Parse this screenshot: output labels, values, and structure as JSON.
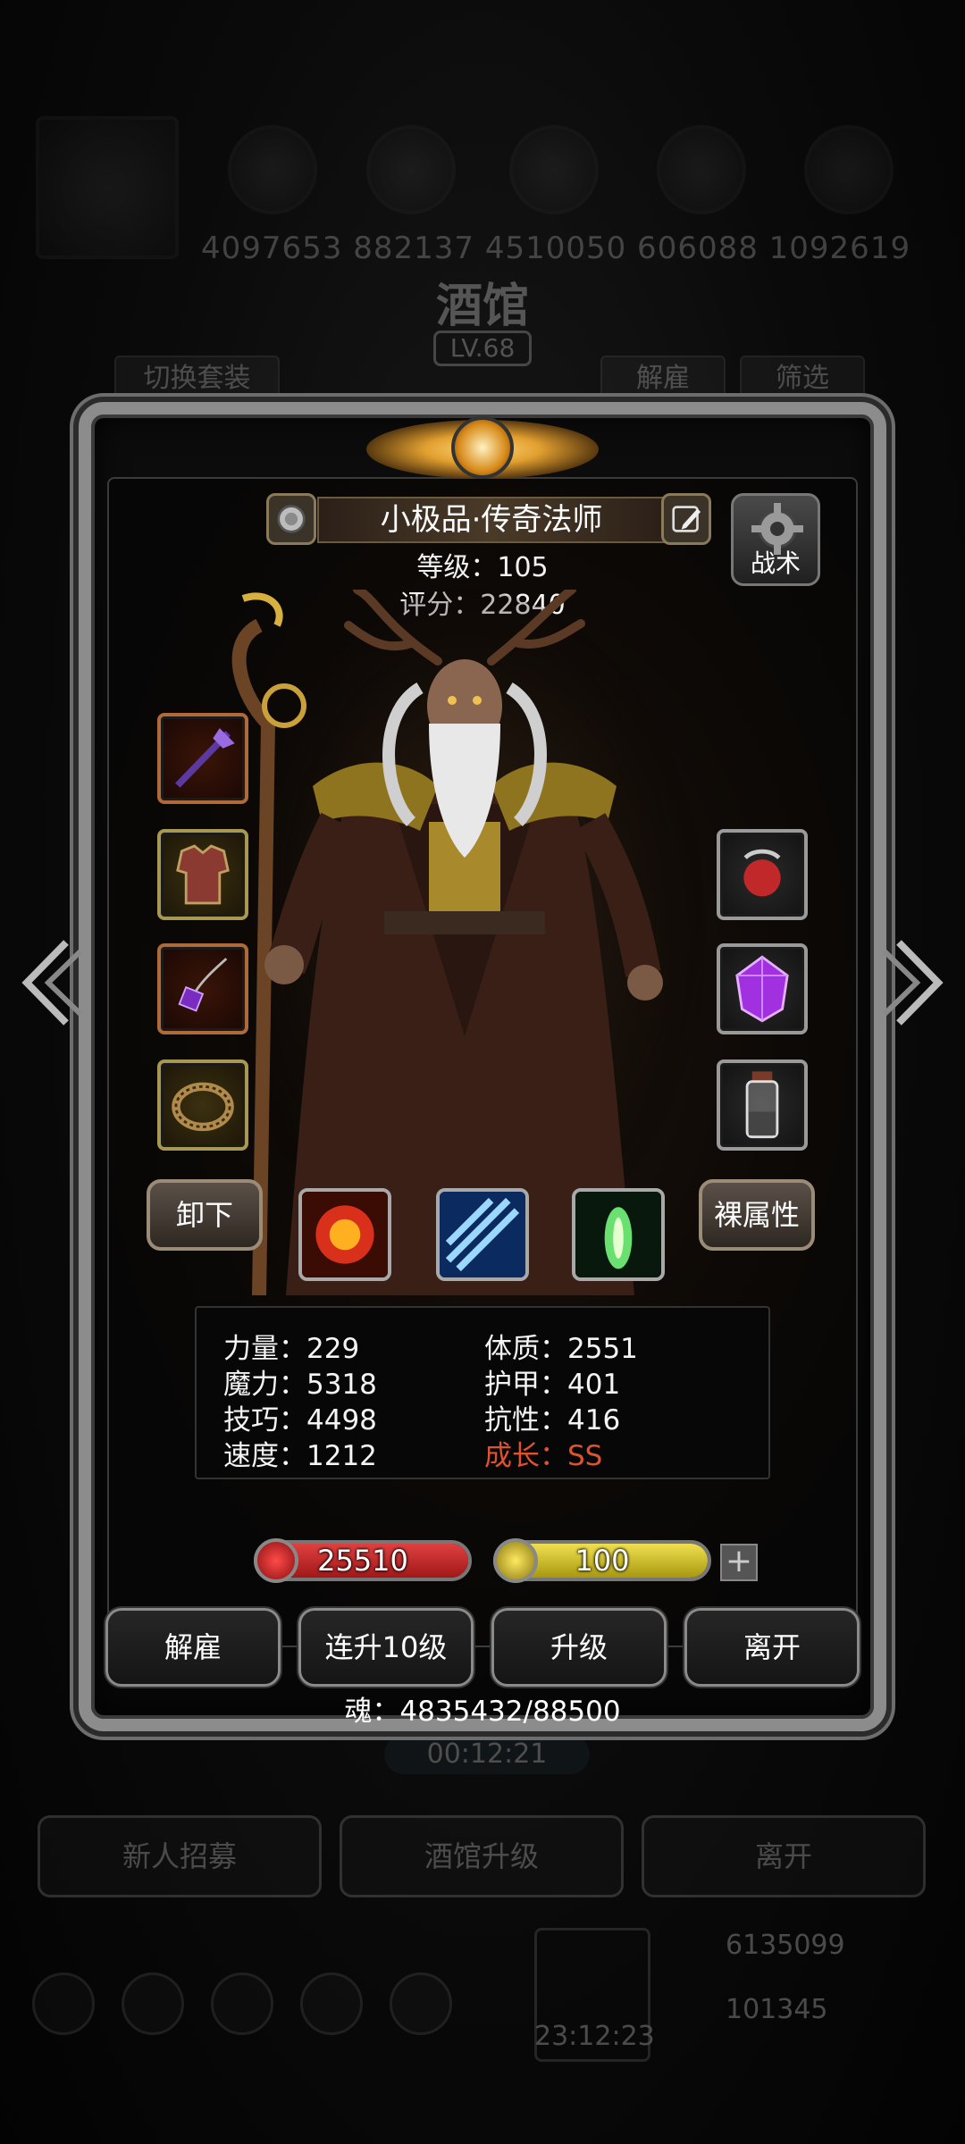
{
  "background": {
    "numbers": "4097653  882137  4510050  606088  1092619",
    "title": "酒馆",
    "level": "LV.68",
    "switch_set": "切换套装",
    "dismiss": "解雇",
    "filter": "筛选",
    "timer": "00:12:21",
    "buttons": [
      "新人招募",
      "酒馆升级",
      "离开"
    ],
    "bottom_timer": "23:12:23",
    "gold": "6135099",
    "gems": "101345"
  },
  "hero": {
    "name": "小极品·传奇法师",
    "level_label": "等级：105",
    "score_label": "评分：22840",
    "tactic_label": "战术"
  },
  "equipment": {
    "left": [
      "staff-icon",
      "armor-icon",
      "amulet-icon",
      "ring-icon"
    ],
    "right": [
      "orb-icon",
      "gem-icon",
      "potion-icon"
    ]
  },
  "controls": {
    "unequip": "卸下",
    "base_attributes": "裸属性"
  },
  "skills": [
    "fire-burst-icon",
    "ice-slash-icon",
    "nature-light-icon"
  ],
  "stats": {
    "strength": "力量：229",
    "magic": "魔力：5318",
    "skill": "技巧：4498",
    "speed": "速度：1212",
    "constitution": "体质：2551",
    "armor": "护甲：401",
    "resistance": "抗性：416",
    "growth": "成长：SS"
  },
  "vitals": {
    "hp": "25510",
    "energy": "100"
  },
  "actions": [
    "解雇",
    "连升10级",
    "升级",
    "离开"
  ],
  "soul": "魂：4835432/88500",
  "colors": {
    "growth": "#e0512e",
    "hp_bar": "#c62424",
    "energy_bar": "#d4c42a"
  }
}
